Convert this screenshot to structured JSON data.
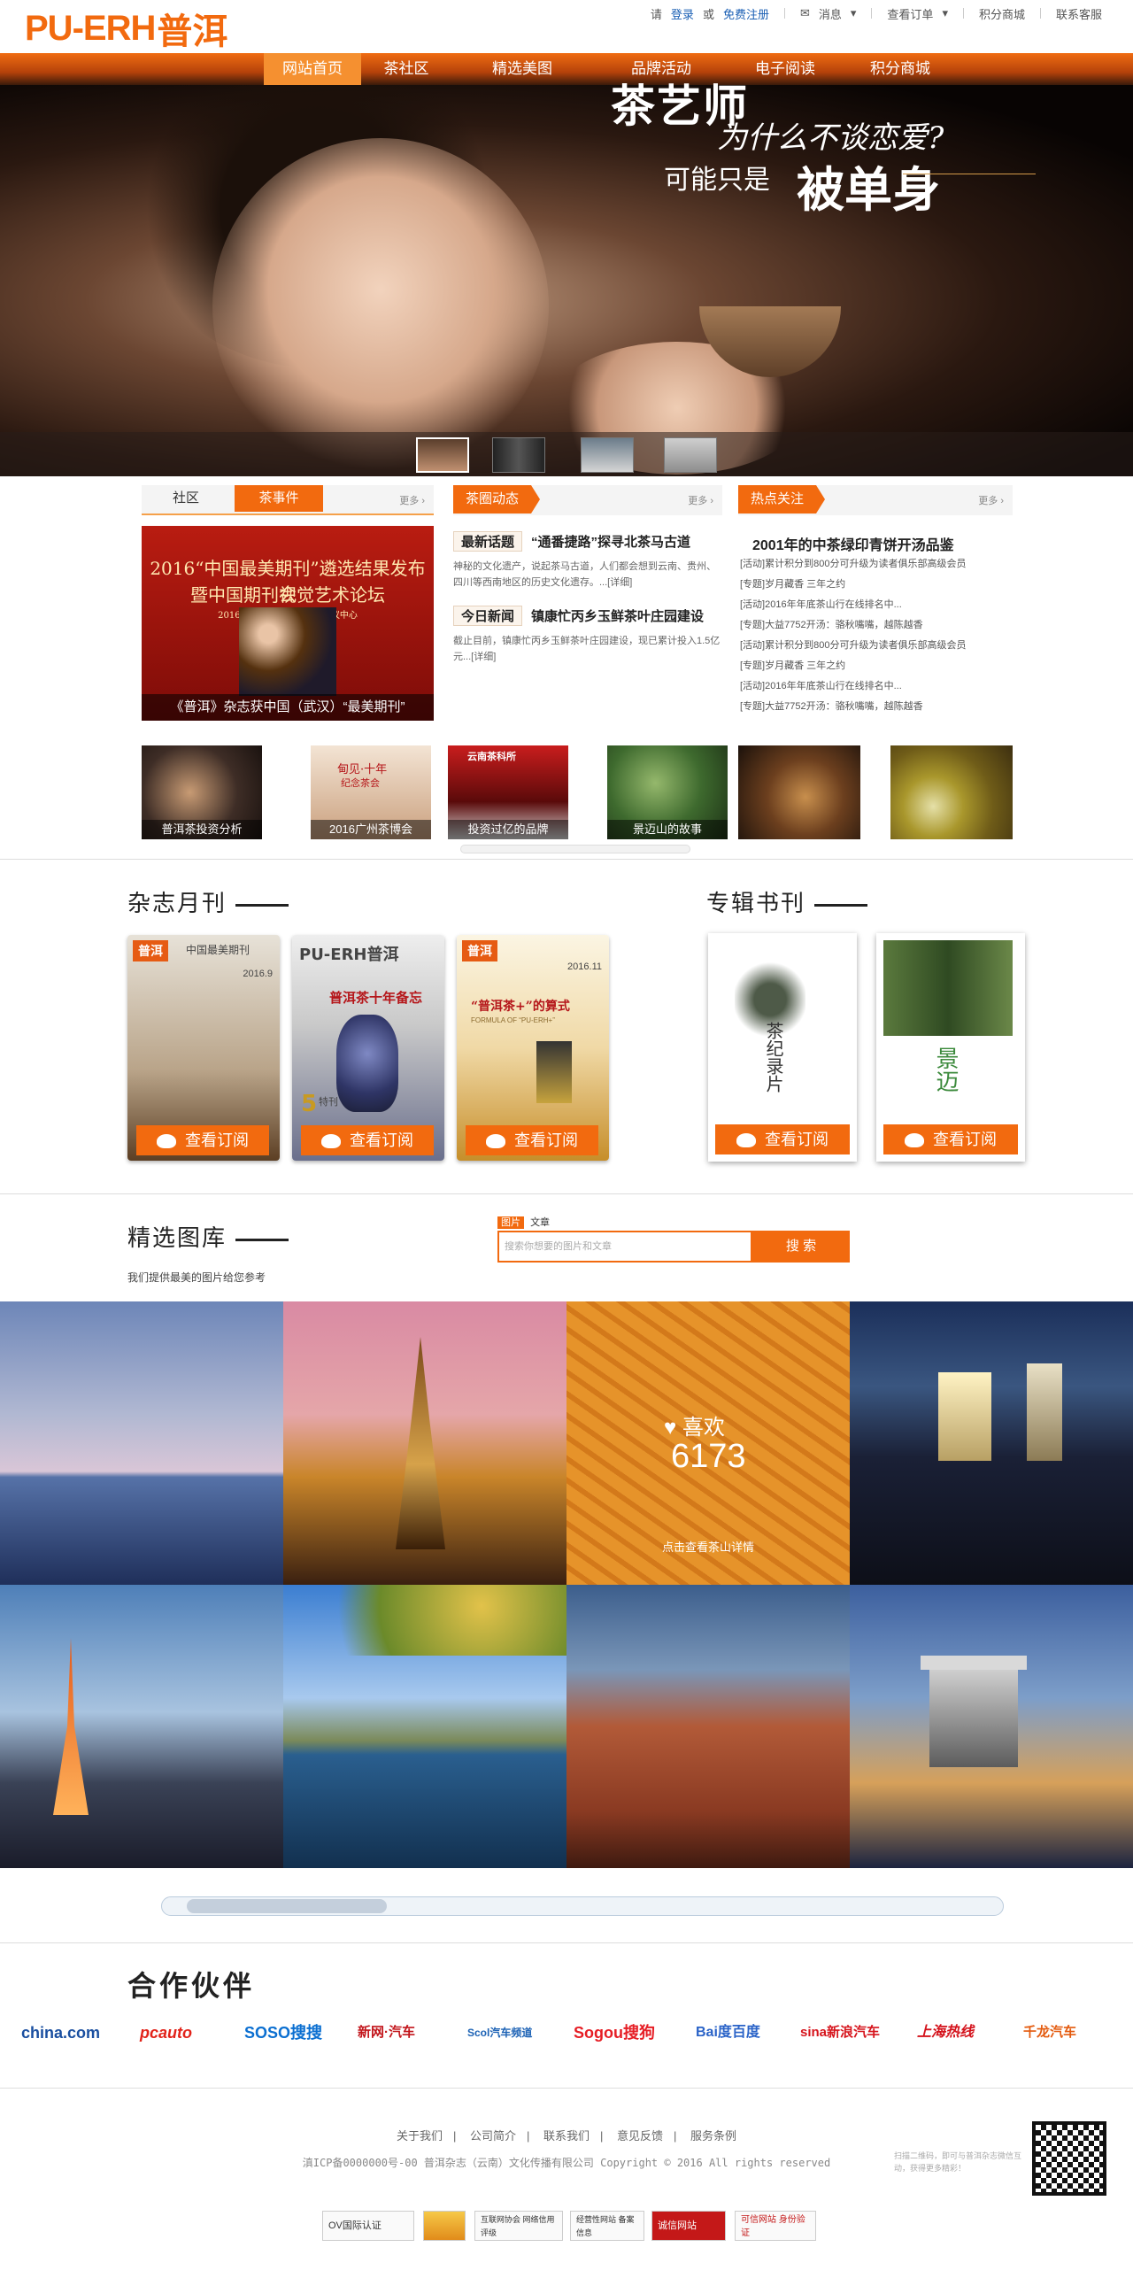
{
  "brand": {
    "logo_en": "PU-ERH",
    "logo_cn": "普洱",
    "accent": "#f26a0f"
  },
  "toplinks": {
    "please": "请",
    "login": "登录",
    "or": "或",
    "register": "免费注册",
    "messages": "消息",
    "orders": "查看订单",
    "points_mall": "积分商城",
    "support": "联系客服"
  },
  "nav": [
    "网站首页",
    "茶社区",
    "精选美图",
    "品牌活动",
    "电子阅读",
    "积分商城"
  ],
  "hero": {
    "line1": "茶艺师",
    "line2": "为什么不谈恋爱?",
    "line3": "可能只是",
    "line4": "被单身"
  },
  "community": {
    "tabs": [
      "社区",
      "茶事件"
    ],
    "more": "更多",
    "image_title1": "2016“中国最美期刊”遴选结果发布会",
    "image_title2": "暨中国期刊视觉艺术论坛",
    "image_sub": "2016年9月24日 武汉国际会议中心",
    "caption": "《普洱》杂志获中国（武汉）“最美期刊”"
  },
  "tea_news": {
    "header": "茶圈动态",
    "more": "更多",
    "tag1": "最新话题",
    "title1": "“通番捷路”探寻北茶马古道",
    "text1": "神秘的文化遗产，说起茶马古道，人们都会想到云南、贵州、四川等西南地区的历史文化遗存。...[详细]",
    "tag2": "今日新闻",
    "title2": "镇康忙丙乡玉鲜茶叶庄园建设",
    "text2": "截止目前，镇康忙丙乡玉鲜茶叶庄园建设，现已累计投入1.5亿元...[详细]"
  },
  "hot": {
    "header": "热点关注",
    "more": "更多",
    "title": "2001年的中茶绿印青饼开汤品鉴",
    "items": [
      "[活动]累计积分到800分可升级为读者俱乐部高级会员",
      "[专题]岁月藏香 三年之约",
      "[活动]2016年年底茶山行在线排名中...",
      "[专题]大益7752开汤：骆秋嘴嘴，越陈越香",
      "[活动]累计积分到800分可升级为读者俱乐部高级会员",
      "[专题]岁月藏香 三年之约",
      "[活动]2016年年底茶山行在线排名中...",
      "[专题]大益7752开汤：骆秋嘴嘴，越陈越香"
    ]
  },
  "strip": [
    {
      "caption": "普洱茶投资分析"
    },
    {
      "caption": "2016广州茶博会",
      "sign1": "甸见·十年",
      "sign2": "纪念茶会"
    },
    {
      "caption": "投资过亿的品牌",
      "sign": "云南茶科所"
    },
    {
      "caption": "景迈山的故事"
    },
    {
      "caption": ""
    },
    {
      "caption": ""
    }
  ],
  "magazines": {
    "title": "杂志月刊",
    "button": "查看订阅",
    "items": [
      {
        "cover_title": "中国最美期刊",
        "brand": "普洱",
        "issue": "2016.9",
        "pages": ""
      },
      {
        "cover_title": "普洱茶十年备忘",
        "brand": "PU-ERH普洱",
        "issue": "5",
        "pages": "特刊"
      },
      {
        "cover_title": "“普洱茶+”的算式",
        "brand": "普洱",
        "issue": "2016.11",
        "pages": "FORMULA OF “PU-ERH+”"
      }
    ]
  },
  "books": {
    "title": "专辑书刊",
    "button": "查看订阅",
    "items": [
      {
        "cover_title": "茶纪录片"
      },
      {
        "cover_title": "景迈"
      }
    ]
  },
  "gallery": {
    "title": "精选图库",
    "subtitle": "我们提供最美的图片给您参考",
    "search_tabs": [
      "图片",
      "文章"
    ],
    "search_placeholder": "搜索你想要的图片和文章",
    "search_button": "搜 索",
    "like_label": "喜欢",
    "like_count": "6173",
    "like_link": "点击查看茶山详情"
  },
  "partners": {
    "title": "合作伙伴",
    "items": [
      "china.com",
      "pcauto",
      "SOSO搜搜",
      "新网·汽车",
      "Scol汽车频道",
      "Sogou搜狗",
      "Bai度百度",
      "sina新浪汽车",
      "上海热线",
      "千龙汽车"
    ],
    "colors": [
      "#1a4fa0",
      "#e2231a",
      "#0b6fd1",
      "#c2151b",
      "#1c62b5",
      "#e61e25",
      "#2a63c8",
      "#d6141c",
      "#d4121b",
      "#e45b0f"
    ]
  },
  "footer": {
    "links": [
      "关于我们",
      "公司简介",
      "联系我们",
      "意见反馈",
      "服务条例"
    ],
    "icp": "滇ICP备0000000号-00  普洱杂志（云南）文化传播有限公司 Copyright © 2016 All rights reserved",
    "qr_text": "扫描二维码，即可与普洱杂志微信互动，获得更多精彩！",
    "badges": [
      "OV国际认证",
      "",
      "互联网协会 网络信用评级",
      "经营性网站 备案信息",
      "诚信网站",
      "可信网站 身份验证"
    ]
  }
}
